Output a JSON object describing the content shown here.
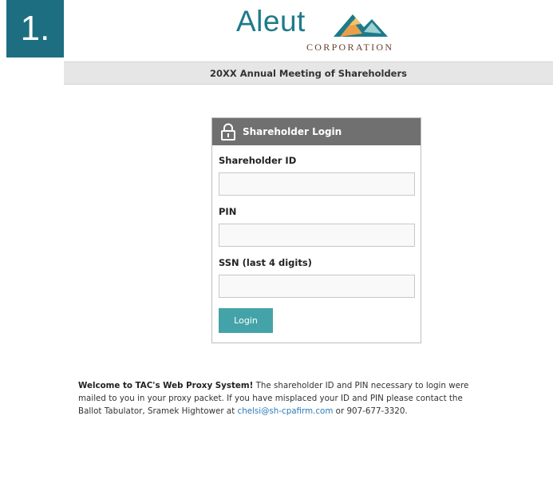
{
  "step": {
    "number": "1."
  },
  "logo": {
    "word": "Aleut",
    "sub": "CORPORATION"
  },
  "meeting": {
    "title": "20XX Annual Meeting of Shareholders"
  },
  "login": {
    "header": "Shareholder Login",
    "fields": [
      {
        "label": "Shareholder ID",
        "value": "",
        "placeholder": ""
      },
      {
        "label": "PIN",
        "value": "",
        "placeholder": ""
      },
      {
        "label": "SSN (last 4 digits)",
        "value": "",
        "placeholder": ""
      }
    ],
    "button": "Login"
  },
  "welcome": {
    "bold": "Welcome to TAC's Web Proxy System!",
    "line1": " The shareholder ID and PIN necessary to login were",
    "line2": "mailed to you in your proxy packet. If you have misplaced your ID and PIN please contact the",
    "line3_pre": "Ballot Tabulator, Sramek Hightower at ",
    "email": "chelsi@sh-cpafirm.com",
    "line3_post": " or 907-677-3320."
  },
  "colors": {
    "badge": "#1d6e80",
    "logo_teal": "#1e7a8a",
    "header_gray": "#707070",
    "button_teal": "#44a3a8",
    "link": "#2b7bb9"
  },
  "icons": {
    "login_header": "lock-icon",
    "logo": "mountain-logo-icon"
  }
}
